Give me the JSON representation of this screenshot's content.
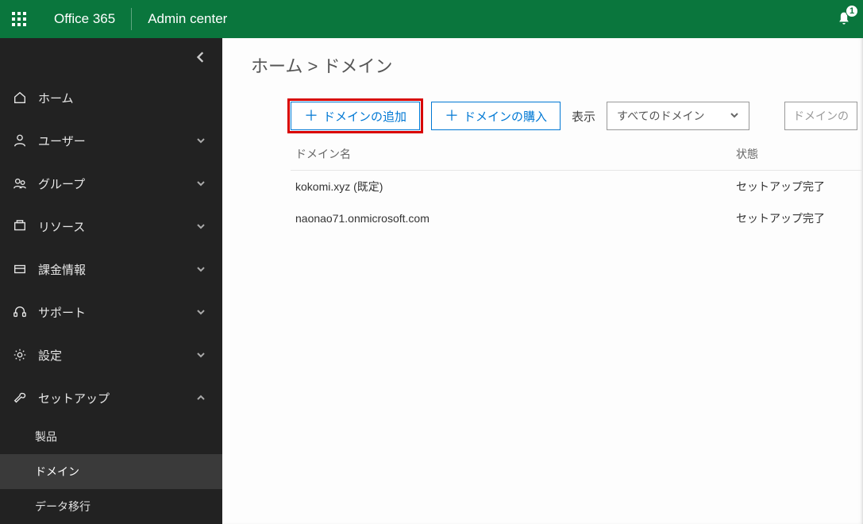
{
  "header": {
    "app_title": "Office 365",
    "subtitle": "Admin center",
    "notifications_count": "1"
  },
  "sidebar": {
    "items": [
      {
        "label": "ホーム",
        "icon": "home",
        "expandable": false
      },
      {
        "label": "ユーザー",
        "icon": "user",
        "expandable": true
      },
      {
        "label": "グループ",
        "icon": "group",
        "expandable": true
      },
      {
        "label": "リソース",
        "icon": "resource",
        "expandable": true
      },
      {
        "label": "課金情報",
        "icon": "billing",
        "expandable": true
      },
      {
        "label": "サポート",
        "icon": "support",
        "expandable": true
      },
      {
        "label": "設定",
        "icon": "settings",
        "expandable": true
      },
      {
        "label": "セットアップ",
        "icon": "setup",
        "expandable": true,
        "expanded": true,
        "children": [
          {
            "label": "製品"
          },
          {
            "label": "ドメイン",
            "active": true
          },
          {
            "label": "データ移行"
          }
        ]
      }
    ]
  },
  "breadcrumb": {
    "home": "ホーム",
    "sep": ">",
    "current": "ドメイン"
  },
  "toolbar": {
    "add_domain": "ドメインの追加",
    "buy_domain": "ドメインの購入",
    "filter_label": "表示",
    "filter_value": "すべてのドメイン",
    "search_placeholder": "ドメインの"
  },
  "table": {
    "col_name": "ドメイン名",
    "col_status": "状態",
    "rows": [
      {
        "name": "kokomi.xyz (既定)",
        "status": "セットアップ完了"
      },
      {
        "name": "naonao71.onmicrosoft.com",
        "status": "セットアップ完了"
      }
    ]
  }
}
